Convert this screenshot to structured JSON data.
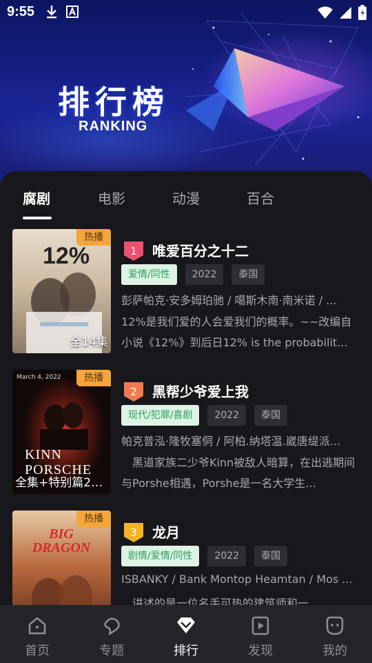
{
  "status_bar": {
    "time": "9:55",
    "left_icons": [
      "download-icon",
      "font-a-icon"
    ],
    "right_icons": [
      "wifi-icon",
      "signal-icon",
      "battery-icon"
    ]
  },
  "banner": {
    "title": "排行榜",
    "subtitle": "RANKING"
  },
  "tabs": [
    {
      "label": "腐剧",
      "active": true
    },
    {
      "label": "电影",
      "active": false
    },
    {
      "label": "动漫",
      "active": false
    },
    {
      "label": "百合",
      "active": false
    }
  ],
  "items": [
    {
      "rank": "1",
      "rank_color": "#ee4f73",
      "title": "唯爱百分之十二",
      "badge": "热播",
      "episodes": "全14集",
      "poster_text": "12%",
      "tags": [
        "爱情/同性",
        "2022",
        "泰国"
      ],
      "cast": "彭萨帕克·安多姆珀驰 / 噶斯木南·南米诺 / ...",
      "description": "12%是我们爱的人会爱我们的概率。~~改编自小说《12%》到后日12% is the probabilit..."
    },
    {
      "rank": "2",
      "rank_color": "#f07a4e",
      "title": "黑帮少爷爱上我",
      "badge": "热播",
      "episodes": "全集+特别篇25...",
      "poster_text": "KINN PORSCHE",
      "poster_date": "March 4, 2022",
      "tags": [
        "现代/犯罪/喜剧",
        "2022",
        "泰国"
      ],
      "cast": "帕克普泓·隆牧塞侗 / 阿柏.纳塔温.崴唐缇派...",
      "description": "　黑道家族二少爷Kinn被敌人暗算，在出逃期间与Porshe相遇，Porshe是一名大学生..."
    },
    {
      "rank": "3",
      "rank_color": "#f4b324",
      "title": "龙月",
      "badge": "热播",
      "episodes": "",
      "poster_text": "BIG DRAGON",
      "tags": [
        "剧情/爱情/同性",
        "2022",
        "泰国"
      ],
      "cast": "ISBANKY / Bank Montop Heamtan / Mos ...",
      "description": "　讲述的是一位名手可热的建筑师和一..."
    }
  ],
  "bottom_nav": [
    {
      "label": "首页",
      "icon": "home-icon",
      "active": false
    },
    {
      "label": "专题",
      "icon": "topic-icon",
      "active": false
    },
    {
      "label": "排行",
      "icon": "diamond-icon",
      "active": true
    },
    {
      "label": "发现",
      "icon": "play-icon",
      "active": false
    },
    {
      "label": "我的",
      "icon": "profile-icon",
      "active": false
    }
  ]
}
